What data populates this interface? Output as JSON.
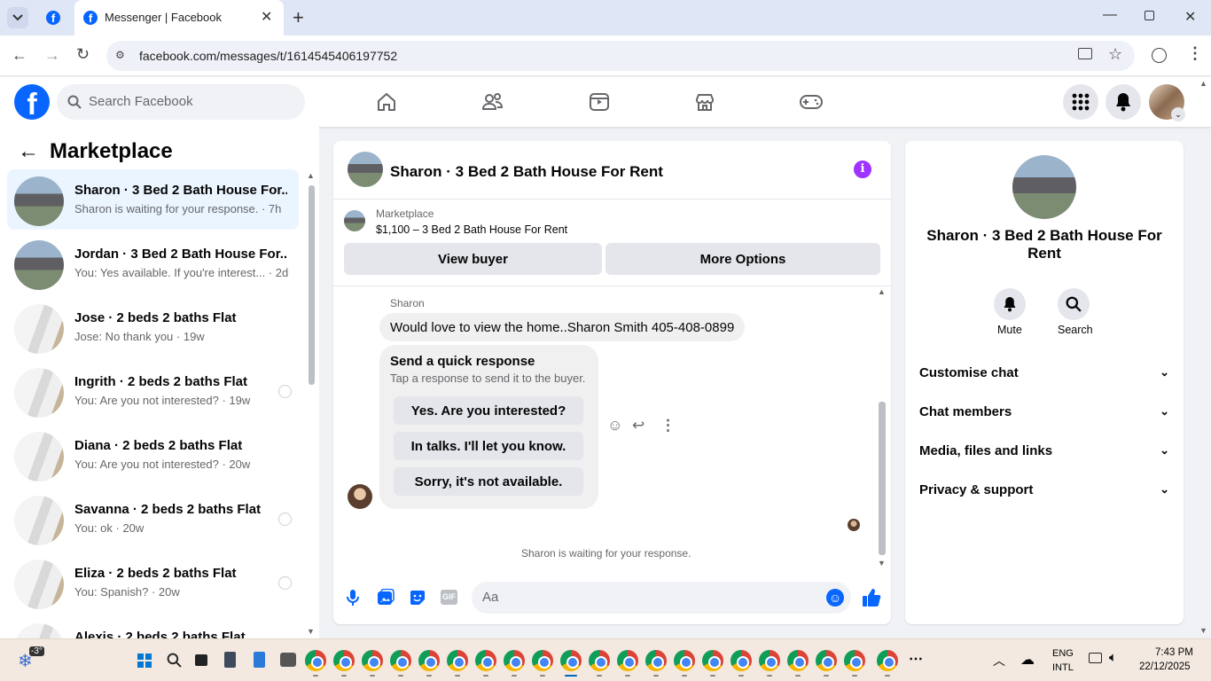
{
  "browser": {
    "tab_title": "Messenger | Facebook",
    "url": "facebook.com/messages/t/1614545406197752"
  },
  "header": {
    "search_placeholder": "Search Facebook"
  },
  "left": {
    "title": "Marketplace",
    "conversations": [
      {
        "title": "Sharon · 3 Bed 2 Bath House For...",
        "subtitle": "Sharon is waiting for your response. · 7h",
        "thumb": "house",
        "active": true
      },
      {
        "title": "Jordan · 3 Bed 2 Bath House For...",
        "subtitle": "You: Yes available. If you're interest... · 2d",
        "thumb": "house"
      },
      {
        "title": "Jose · 2 beds 2 baths Flat",
        "subtitle": "Jose: No thank you · 19w",
        "thumb": "room"
      },
      {
        "title": "Ingrith · 2 beds 2 baths Flat",
        "subtitle": "You: Are you not interested? · 19w",
        "thumb": "room",
        "unread_circle": true
      },
      {
        "title": "Diana · 2 beds 2 baths Flat",
        "subtitle": "You: Are you not interested? · 20w",
        "thumb": "room"
      },
      {
        "title": "Savanna · 2 beds 2 baths Flat",
        "subtitle": "You: ok · 20w",
        "thumb": "room",
        "unread_circle": true
      },
      {
        "title": "Eliza · 2 beds 2 baths Flat",
        "subtitle": "You: Spanish? · 20w",
        "thumb": "room",
        "unread_circle": true
      },
      {
        "title": "Alexis · 2 beds 2 baths Flat",
        "subtitle": "",
        "thumb": "room"
      }
    ]
  },
  "chat": {
    "title": "Sharon · 3 Bed 2 Bath House For Rent",
    "listing_label": "Marketplace",
    "listing_price": "$1,100 – 3 Bed 2 Bath House For Rent",
    "view_buyer": "View buyer",
    "more_options": "More Options",
    "sender": "Sharon",
    "message": "Would love to view the home..Sharon Smith 405-408-0899",
    "quick_title": "Send a quick response",
    "quick_sub": "Tap a response to send it to the buyer.",
    "quick_replies": [
      "Yes. Are you interested?",
      "In talks. I'll let you know.",
      "Sorry, it's not available."
    ],
    "waiting": "Sharon is waiting for your response.",
    "composer_placeholder": "Aa",
    "gif_label": "GIF"
  },
  "right": {
    "title": "Sharon · 3 Bed 2 Bath House For Rent",
    "mute": "Mute",
    "search": "Search",
    "sections": [
      "Customise chat",
      "Chat members",
      "Media, files and links",
      "Privacy & support"
    ]
  },
  "taskbar": {
    "weather": "-3°",
    "lang1": "ENG",
    "lang2": "INTL",
    "time": "7:43 PM",
    "date": "22/12/2025"
  },
  "colors": {
    "fb_blue": "#0866ff",
    "messenger_purple": "#a033ff",
    "active_bg": "#ebf5ff"
  }
}
